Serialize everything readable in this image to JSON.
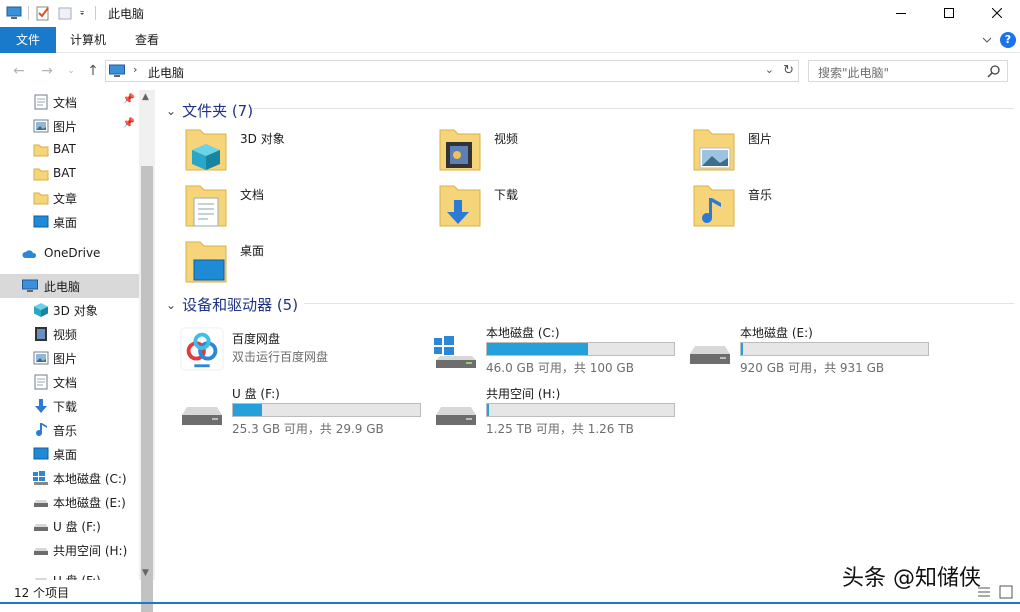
{
  "window": {
    "title": "此电脑"
  },
  "ribbon": {
    "tabs": [
      "文件",
      "计算机",
      "查看"
    ]
  },
  "address": {
    "crumb": "此电脑",
    "search_placeholder": "搜索\"此电脑\""
  },
  "sidebar": {
    "items": [
      {
        "label": "文档",
        "icon": "document-icon",
        "pinned": true
      },
      {
        "label": "图片",
        "icon": "picture-icon",
        "pinned": true
      },
      {
        "label": "BAT",
        "icon": "folder-icon"
      },
      {
        "label": "BAT",
        "icon": "folder-icon"
      },
      {
        "label": "文章",
        "icon": "folder-icon"
      },
      {
        "label": "桌面",
        "icon": "desktop-icon"
      },
      {
        "label": "OneDrive",
        "icon": "onedrive-icon"
      },
      {
        "label": "此电脑",
        "icon": "pc-icon",
        "selected": true
      },
      {
        "label": "3D 对象",
        "icon": "3d-objects-icon"
      },
      {
        "label": "视频",
        "icon": "video-icon"
      },
      {
        "label": "图片",
        "icon": "picture-icon"
      },
      {
        "label": "文档",
        "icon": "document-icon"
      },
      {
        "label": "下载",
        "icon": "download-icon"
      },
      {
        "label": "音乐",
        "icon": "music-icon"
      },
      {
        "label": "桌面",
        "icon": "desktop-icon"
      },
      {
        "label": "本地磁盘 (C:)",
        "icon": "windows-drive-icon"
      },
      {
        "label": "本地磁盘 (E:)",
        "icon": "drive-icon"
      },
      {
        "label": "U 盘 (F:)",
        "icon": "drive-icon"
      },
      {
        "label": "共用空间 (H:)",
        "icon": "drive-icon"
      },
      {
        "label": "U 盘 (F:)",
        "icon": "drive-icon"
      }
    ]
  },
  "folders_group": {
    "title": "文件夹 (7)"
  },
  "folders": [
    {
      "label": "3D 对象",
      "icon": "3d-objects-folder-icon"
    },
    {
      "label": "视频",
      "icon": "video-folder-icon"
    },
    {
      "label": "图片",
      "icon": "picture-folder-icon"
    },
    {
      "label": "文档",
      "icon": "document-folder-icon"
    },
    {
      "label": "下载",
      "icon": "download-folder-icon"
    },
    {
      "label": "音乐",
      "icon": "music-folder-icon"
    },
    {
      "label": "桌面",
      "icon": "desktop-folder-icon"
    }
  ],
  "devices_group": {
    "title": "设备和驱动器 (5)"
  },
  "baidu": {
    "name": "百度网盘",
    "desc": "双击运行百度网盘"
  },
  "drives": [
    {
      "name": "本地磁盘 (C:)",
      "size": "46.0 GB 可用，共 100 GB",
      "used_fraction": 0.54,
      "icon": "windows-drive-icon"
    },
    {
      "name": "本地磁盘 (E:)",
      "size": "920 GB 可用，共 931 GB",
      "used_fraction": 0.012,
      "icon": "drive-icon"
    },
    {
      "name": "U 盘 (F:)",
      "size": "25.3 GB 可用，共 29.9 GB",
      "used_fraction": 0.154,
      "icon": "drive-icon"
    },
    {
      "name": "共用空间 (H:)",
      "size": "1.25 TB 可用，共 1.26 TB",
      "used_fraction": 0.008,
      "icon": "drive-icon"
    }
  ],
  "status": {
    "text": "12 个项目"
  },
  "watermark": {
    "text": "头条 @知储侠"
  },
  "colors": {
    "accent": "#1979ca",
    "bar_fill": "#26a0da",
    "selection": "#d9d9d9",
    "group_title": "#1e3287",
    "folder": "#f6d47a"
  }
}
